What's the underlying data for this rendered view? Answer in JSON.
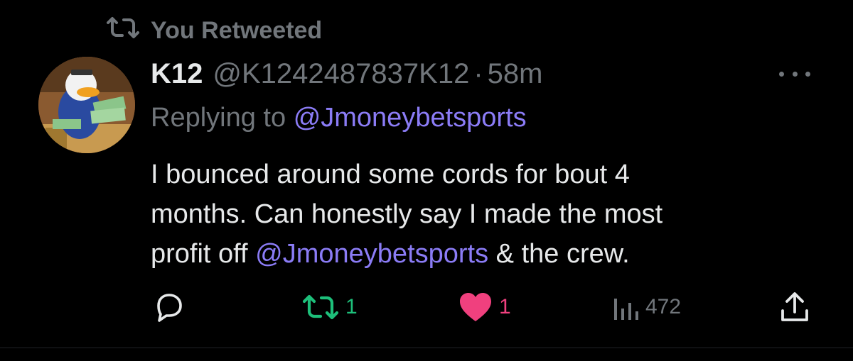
{
  "retweet_header": {
    "label": "You Retweeted",
    "icon": "retweet-icon"
  },
  "tweet": {
    "display_name": "K12",
    "handle": "@K1242487837K12",
    "separator": "·",
    "timestamp": "58m",
    "reply_prefix": "Replying to",
    "reply_mention": "@Jmoneybetsports",
    "body_line_1": "I bounced around some cords for bout 4",
    "body_line_2": "months. Can honestly say I made the most",
    "body_line_3_prefix": "profit off",
    "body_line_3_mention": "@Jmoneybetsports",
    "body_line_3_suffix": "& the crew."
  },
  "actions": {
    "reply": {
      "icon": "reply-icon"
    },
    "retweet": {
      "icon": "retweet-icon",
      "count": "1",
      "color": "#1dbf7a"
    },
    "like": {
      "icon": "heart-icon",
      "count": "1",
      "color": "#f0407e"
    },
    "views": {
      "icon": "views-chart-icon",
      "count": "472"
    },
    "share": {
      "icon": "share-icon"
    }
  },
  "colors": {
    "background": "#000000",
    "primary_text": "#e7e9ea",
    "secondary_text": "#71767b",
    "mention": "#8b7cf6"
  }
}
